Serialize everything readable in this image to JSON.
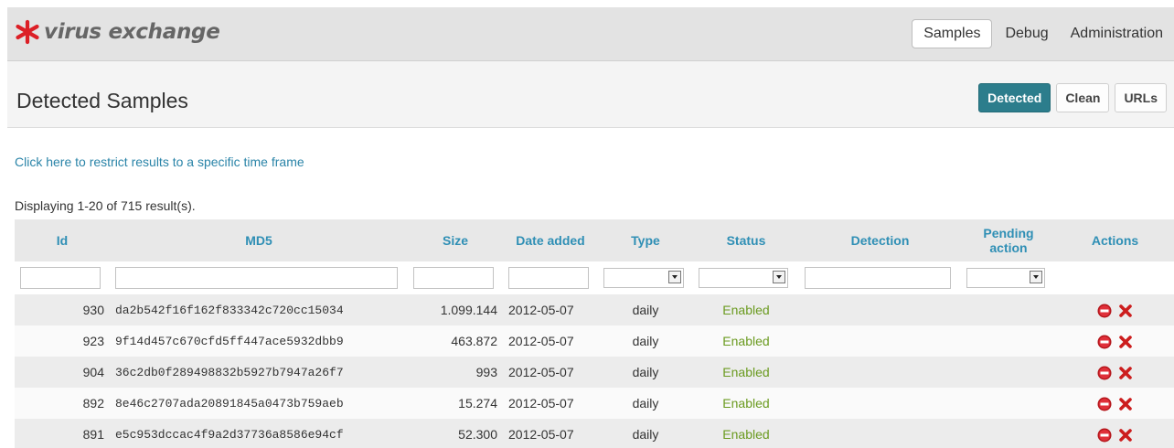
{
  "brand": {
    "name": "virus exchange",
    "accent": "#dc1f26"
  },
  "nav": {
    "items": [
      {
        "label": "Samples",
        "active": true
      },
      {
        "label": "Debug",
        "active": false
      },
      {
        "label": "Administration",
        "active": false
      }
    ]
  },
  "page": {
    "title": "Detected Samples"
  },
  "filters": {
    "tabs": [
      {
        "label": "Detected",
        "active": true
      },
      {
        "label": "Clean",
        "active": false
      },
      {
        "label": "URLs",
        "active": false
      }
    ]
  },
  "time_link": "Click here to restrict results to a specific time frame",
  "result_count": "Displaying 1-20 of 715 result(s).",
  "table": {
    "columns": [
      "Id",
      "MD5",
      "Size",
      "Date added",
      "Type",
      "Status",
      "Detection",
      "Pending action",
      "Actions"
    ],
    "rows": [
      {
        "id": "930",
        "md5": "da2b542f16f162f833342c720cc15034",
        "size": "1.099.144",
        "date": "2012-05-07",
        "type": "daily",
        "status": "Enabled",
        "detection": ""
      },
      {
        "id": "923",
        "md5": "9f14d457c670cfd5ff447ace5932dbb9",
        "size": "463.872",
        "date": "2012-05-07",
        "type": "daily",
        "status": "Enabled",
        "detection": ""
      },
      {
        "id": "904",
        "md5": "36c2db0f289498832b5927b7947a26f7",
        "size": "993",
        "date": "2012-05-07",
        "type": "daily",
        "status": "Enabled",
        "detection": ""
      },
      {
        "id": "892",
        "md5": "8e46c2707ada20891845a0473b759aeb",
        "size": "15.274",
        "date": "2012-05-07",
        "type": "daily",
        "status": "Enabled",
        "detection": ""
      },
      {
        "id": "891",
        "md5": "e5c953dccac4f9a2d37736a8586e94cf",
        "size": "52.300",
        "date": "2012-05-07",
        "type": "daily",
        "status": "Enabled",
        "detection": ""
      }
    ],
    "row_actions": [
      "disable-icon",
      "delete-icon"
    ]
  },
  "colors": {
    "accent": "#2c7d8c",
    "link": "#2a84a8",
    "header_text": "#2f8fb5",
    "status_enabled": "#6a9a1f",
    "delete": "#cc1d1d"
  }
}
